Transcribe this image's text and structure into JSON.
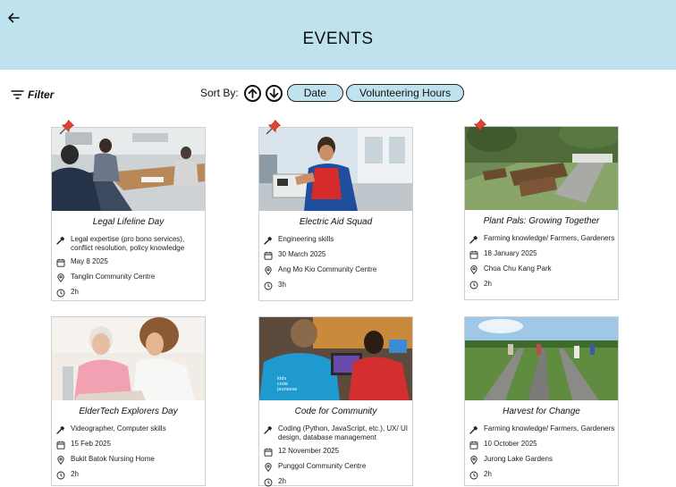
{
  "header": {
    "title": "EVENTS"
  },
  "toolbar": {
    "filter_label": "Filter",
    "sort_label": "Sort By:",
    "sort_options": [
      "Date",
      "Volunteering Hours"
    ]
  },
  "colors": {
    "header_bg": "#bfe3ee",
    "chip_bg": "#bfe3ee",
    "pin": "#e0442e"
  },
  "events": [
    {
      "title": "Legal Lifeline Day",
      "skills": "Legal expertise (pro bono services), conflict resolution, policy knowledge",
      "date": "May 8 2025",
      "location": "Tanglin Community Centre",
      "duration": "2h",
      "pinned": true
    },
    {
      "title": "Electric Aid Squad",
      "skills": "Engineering skills",
      "date": "30 March 2025",
      "location": "Ang Mo Kio Community Centre",
      "duration": "3h",
      "pinned": true
    },
    {
      "title": "Plant Pals: Growing Together",
      "skills": "Farming knowledge/ Farmers, Gardeners",
      "date": "18 January 2025",
      "location": "Choa Chu Kang Park",
      "duration": "2h",
      "pinned": true
    },
    {
      "title": "ElderTech Explorers Day",
      "skills": "Videographer, Computer skills",
      "date": "15 Feb 2025",
      "location": "Bukit Batok Nursing Home",
      "duration": "2h",
      "pinned": false
    },
    {
      "title": "Code for Community",
      "skills": "Coding (Python, JavaScript, etc.), UX/ UI design, database management",
      "date": "12 November 2025",
      "location": "Punggol Community Centre",
      "duration": "2h",
      "pinned": false
    },
    {
      "title": "Harvest for Change",
      "skills": "Farming knowledge/ Farmers, Gardeners",
      "date": "10 October 2025",
      "location": "Jurong Lake Gardens",
      "duration": "2h",
      "pinned": false
    }
  ],
  "photo_shirt_text": "kids\ncode\njeunesse"
}
